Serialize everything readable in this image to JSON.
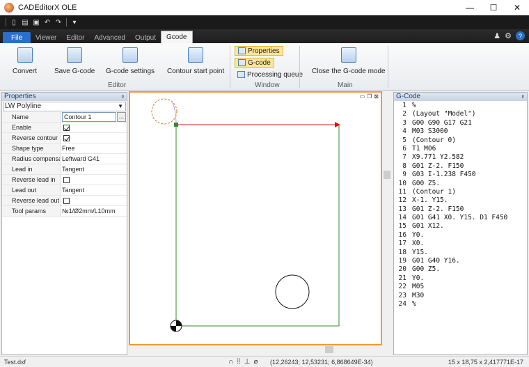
{
  "window": {
    "title": "CADEditorX OLE",
    "minimize": "—",
    "maximize": "☐",
    "close": "✕"
  },
  "ribbon_tabs": [
    {
      "label": "File"
    },
    {
      "label": "Viewer"
    },
    {
      "label": "Editor"
    },
    {
      "label": "Advanced"
    },
    {
      "label": "Output"
    },
    {
      "label": "Gcode"
    }
  ],
  "ribbon": {
    "convert": "Convert",
    "save_gcode": "Save G-code",
    "gcode_settings": "G-code settings",
    "contour_start": "Contour start point",
    "group_editor": "Editor",
    "properties": "Properties",
    "gcode": "G-code",
    "processing_queue": "Processing queue",
    "group_window": "Window",
    "close_gcode_mode": "Close the G-code mode",
    "group_main": "Main",
    "help": "?"
  },
  "properties": {
    "title": "Properties",
    "pin": "ᵖ",
    "object_type": "LW Polyline",
    "rows": [
      {
        "name": "Name",
        "value": "Contour 1"
      },
      {
        "name": "Enable",
        "value": ""
      },
      {
        "name": "Reverse contour",
        "value": ""
      },
      {
        "name": "Shape type",
        "value": "Free"
      },
      {
        "name": "Radius compensation",
        "value": "Leftward G41"
      },
      {
        "name": "Lead in",
        "value": "Tangent"
      },
      {
        "name": "Reverse lead in",
        "value": ""
      },
      {
        "name": "Lead out",
        "value": "Tangent"
      },
      {
        "name": "Reverse lead out",
        "value": ""
      },
      {
        "name": "Tool params",
        "value": "№1/Ø2mm/L10mm"
      }
    ],
    "ellipsis": "..."
  },
  "gcode_panel": {
    "title": "G-Code",
    "lines": [
      {
        "n": "1",
        "t": "%"
      },
      {
        "n": "2",
        "t": "(Layout \"Model\")"
      },
      {
        "n": "3",
        "t": "G00 G90 G17 G21"
      },
      {
        "n": "4",
        "t": "M03 S3000"
      },
      {
        "n": "5",
        "t": "(Contour 0)"
      },
      {
        "n": "6",
        "t": "T1 M06"
      },
      {
        "n": "7",
        "t": "X9.771 Y2.582"
      },
      {
        "n": "8",
        "t": "G01 Z-2. F150"
      },
      {
        "n": "9",
        "t": "G03 I-1.238 F450"
      },
      {
        "n": "10",
        "t": "G00 Z5."
      },
      {
        "n": "11",
        "t": "(Contour 1)"
      },
      {
        "n": "12",
        "t": "X-1. Y15."
      },
      {
        "n": "13",
        "t": "G01 Z-2. F150"
      },
      {
        "n": "14",
        "t": "G01 G41 X0. Y15. D1 F450"
      },
      {
        "n": "15",
        "t": "G01 X12."
      },
      {
        "n": "16",
        "t": "Y0."
      },
      {
        "n": "17",
        "t": "X0."
      },
      {
        "n": "18",
        "t": "Y15."
      },
      {
        "n": "19",
        "t": "G01 G40 Y16."
      },
      {
        "n": "20",
        "t": "G00 Z5."
      },
      {
        "n": "21",
        "t": "Y0."
      },
      {
        "n": "22",
        "t": "M05"
      },
      {
        "n": "23",
        "t": "M30"
      },
      {
        "n": "24",
        "t": "%"
      }
    ]
  },
  "statusbar": {
    "file": "Test.dxf",
    "coords": "(12,26243; 12,53231; 6,868649E-34)",
    "dims": "15 x 18,75 x 2,417771E-17"
  },
  "colors": {
    "accent": "#2a6fc9",
    "frame": "#f39a2a",
    "contour": "#2e8b2e",
    "arrow": "#e01010"
  }
}
